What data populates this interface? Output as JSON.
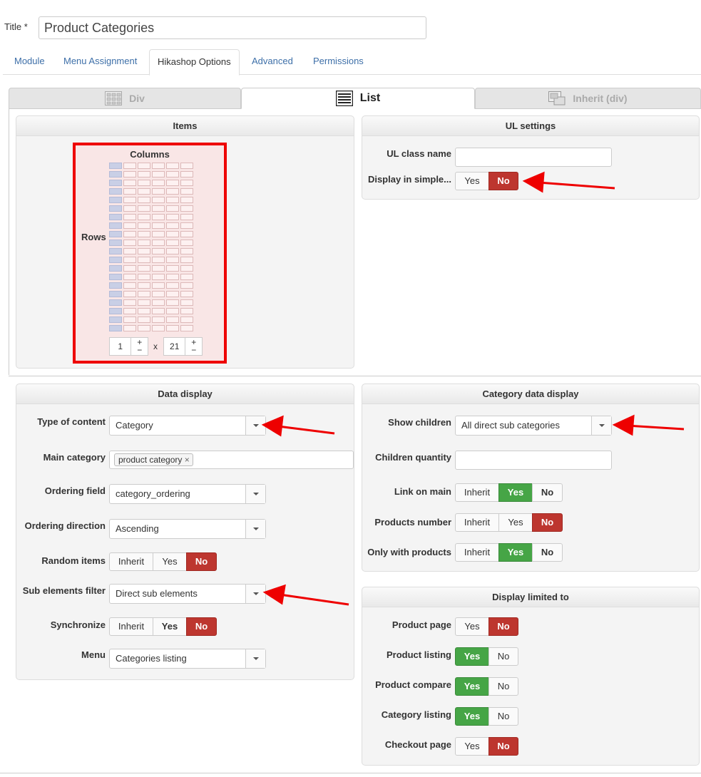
{
  "title": {
    "label": "Title *",
    "value": "Product Categories"
  },
  "tabs": [
    "Module",
    "Menu Assignment",
    "Hikashop Options",
    "Advanced",
    "Permissions"
  ],
  "layout_tabs": {
    "div": "Div",
    "list": "List",
    "inherit": "Inherit (div)"
  },
  "items": {
    "header": "Items",
    "columns": "Columns",
    "rows": "Rows",
    "cols_value": "1",
    "rows_value": "21",
    "x": "x",
    "plus": "+",
    "minus": "−"
  },
  "ul_settings": {
    "header": "UL settings",
    "class_label": "UL class name",
    "simple_label": "Display in simple...",
    "yes": "Yes",
    "no": "No"
  },
  "data_display": {
    "header": "Data display",
    "type_label": "Type of content",
    "type_value": "Category",
    "main_label": "Main category",
    "main_tag": "product category",
    "tag_remove": "×",
    "ordering_label": "Ordering field",
    "ordering_value": "category_ordering",
    "direction_label": "Ordering direction",
    "direction_value": "Ascending",
    "random_label": "Random items",
    "sub_label": "Sub elements filter",
    "sub_value": "Direct sub elements",
    "sync_label": "Synchronize",
    "menu_label": "Menu",
    "menu_value": "Categories listing",
    "inherit": "Inherit",
    "yes": "Yes",
    "no": "No"
  },
  "category_display": {
    "header": "Category data display",
    "children_label": "Show children",
    "children_value": "All direct sub categories",
    "qty_label": "Children quantity",
    "link_label": "Link on main",
    "products_label": "Products number",
    "only_label": "Only with products",
    "inherit": "Inherit",
    "yes": "Yes",
    "no": "No"
  },
  "display_limited": {
    "header": "Display limited to",
    "product_page": "Product page",
    "product_listing": "Product listing",
    "product_compare": "Product compare",
    "category_listing": "Category listing",
    "checkout_page": "Checkout page",
    "yes": "Yes",
    "no": "No"
  },
  "colors": {
    "red": "#bd362f",
    "green": "#46a546",
    "link": "#3d6fa8",
    "highlight": "#e00000"
  }
}
